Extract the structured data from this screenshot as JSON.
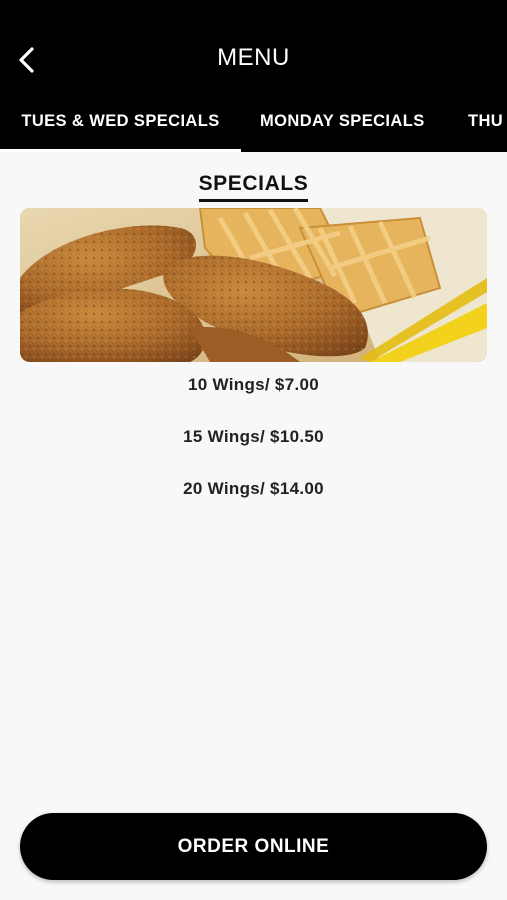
{
  "header": {
    "title": "MENU",
    "back_icon": "chevron-left-icon"
  },
  "tabs": [
    {
      "label": "TUES & WED SPECIALS",
      "active": true
    },
    {
      "label": "MONDAY SPECIALS",
      "active": false
    },
    {
      "label": "THU",
      "active": false
    }
  ],
  "section": {
    "title": "SPECIALS"
  },
  "items": [
    {
      "label": "10 Wings/ $7.00"
    },
    {
      "label": "15 Wings/ $10.50"
    },
    {
      "label": "20 Wings/ $14.00"
    }
  ],
  "order_button": {
    "label": "ORDER ONLINE"
  },
  "colors": {
    "header_bg": "#000000",
    "page_bg": "#f8f8f8",
    "text": "#222222",
    "button_bg": "#000000"
  }
}
